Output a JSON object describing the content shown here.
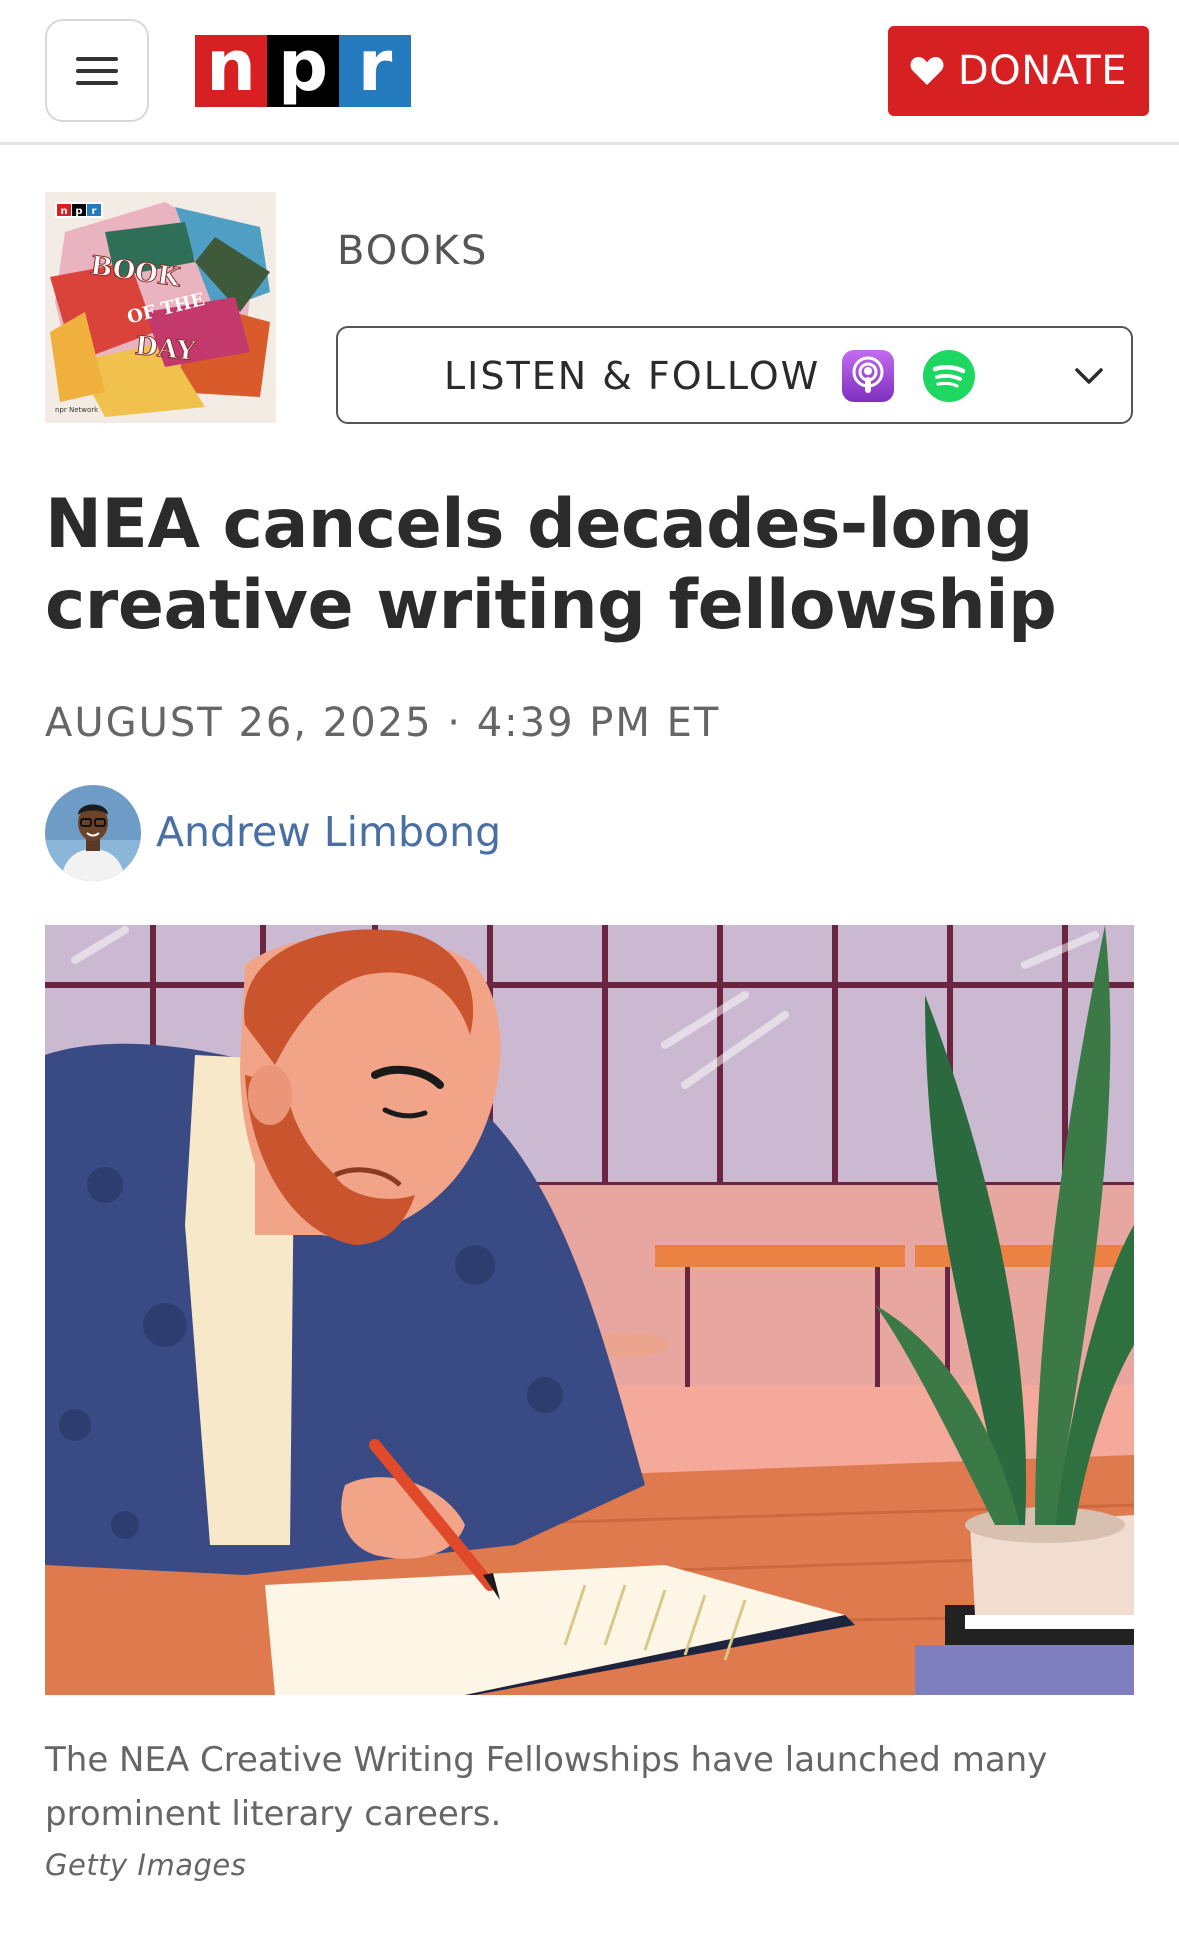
{
  "header": {
    "menu_icon": "hamburger-menu-icon",
    "logo": {
      "letters": [
        "n",
        "p",
        "r"
      ],
      "colors": [
        "#d62021",
        "#000000",
        "#237bbd"
      ]
    },
    "donate": {
      "label": "DONATE",
      "icon": "heart-icon",
      "color": "#d62021"
    }
  },
  "podcast": {
    "art_logo": "npr",
    "art_text_lines": [
      "BOOK",
      "OF THE",
      "DAY"
    ],
    "art_footer": "npr Network",
    "section": "BOOKS",
    "listen_label": "LISTEN & FOLLOW",
    "services": [
      {
        "icon": "apple-podcasts-icon",
        "color": "#9b4fd0"
      },
      {
        "icon": "spotify-icon",
        "color": "#1ed760"
      }
    ],
    "expand_icon": "chevron-down-icon"
  },
  "article": {
    "headline_lines": [
      "NEA cancels decades-long",
      "creative writing fellowship"
    ],
    "dateline": "AUGUST 26, 2025 · 4:39 PM ET",
    "author": "Andrew Limbong",
    "caption": "The NEA Creative Writing Fellowships have launched many prominent literary careers.",
    "credit": "Getty Images"
  },
  "colors": {
    "link": "#4a6fa5",
    "text": "#2b2b2b",
    "muted": "#666666"
  }
}
